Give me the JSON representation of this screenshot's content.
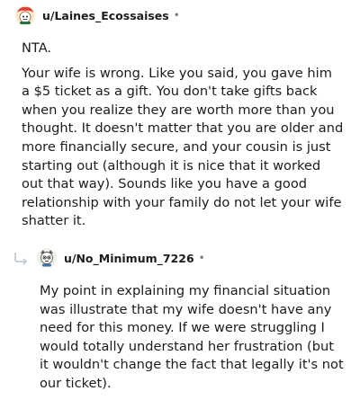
{
  "comments": [
    {
      "username": "u/Laines_Ecossaises",
      "separator": "•",
      "avatar_icon": "snoo-avatar-icon",
      "paragraphs": [
        "NTA.",
        "Your wife is wrong. Like you said, you gave him a $5 ticket as a gift. You don't take gifts back when you realize they are worth more than you thought. It doesn't matter that you are older and more financially secure, and your cousin is just starting out (although it is nice that it worked out that way). Sounds like you have a good relationship with your family do not let your wife shatter it."
      ]
    },
    {
      "username": "u/No_Minimum_7226",
      "separator": "•",
      "avatar_icon": "snoo-avatar-icon",
      "reply_icon": "reply-arrow-icon",
      "paragraphs": [
        "My point in explaining my financial situation was illustrate that my wife doesn't have any need for this money. If we were struggling I would totally understand her frustration (but it wouldn't change the fact that legally it's not our ticket)."
      ]
    }
  ],
  "colors": {
    "text": "#1c1c1c",
    "muted": "#7c7c7c",
    "background": "#ffffff"
  }
}
